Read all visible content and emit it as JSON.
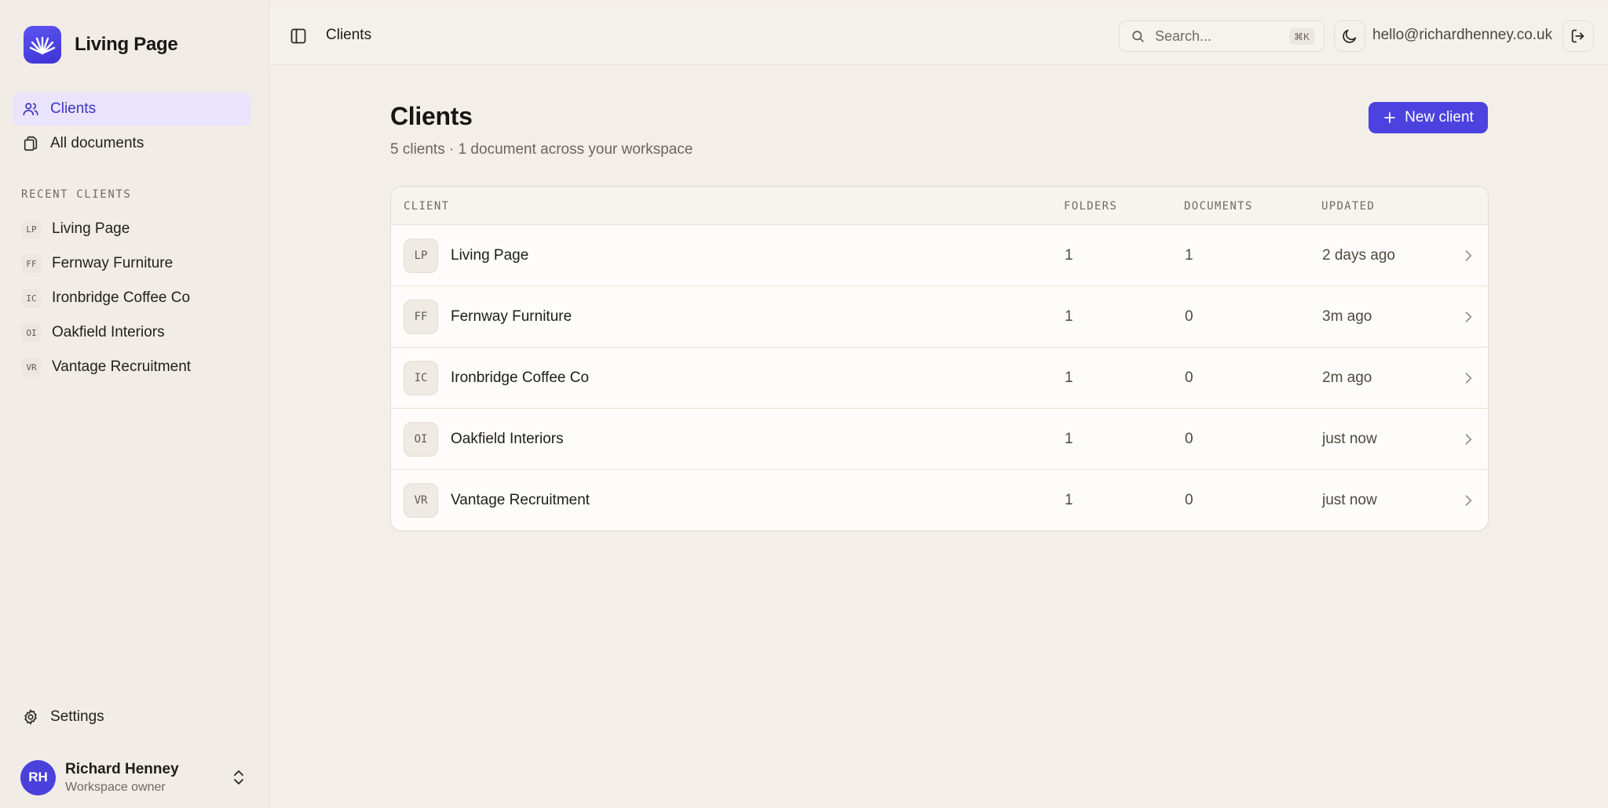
{
  "brand": {
    "name": "Living Page"
  },
  "nav": {
    "items": [
      {
        "label": "Clients",
        "icon": "users-icon",
        "active": true
      },
      {
        "label": "All documents",
        "icon": "documents-icon",
        "active": false
      }
    ]
  },
  "recent": {
    "label": "RECENT CLIENTS",
    "items": [
      {
        "initials": "LP",
        "name": "Living Page"
      },
      {
        "initials": "FF",
        "name": "Fernway Furniture"
      },
      {
        "initials": "IC",
        "name": "Ironbridge Coffee Co"
      },
      {
        "initials": "OI",
        "name": "Oakfield Interiors"
      },
      {
        "initials": "VR",
        "name": "Vantage Recruitment"
      }
    ]
  },
  "settings": {
    "label": "Settings"
  },
  "user": {
    "initials": "RH",
    "name": "Richard Henney",
    "role": "Workspace owner"
  },
  "topbar": {
    "title": "Clients",
    "search_placeholder": "Search...",
    "search_shortcut": "⌘K",
    "email": "hello@richardhenney.co.uk"
  },
  "main": {
    "title": "Clients",
    "subtitle": "5 clients · 1 document across your workspace",
    "new_button": "New client"
  },
  "table": {
    "headers": {
      "client": "CLIENT",
      "folders": "FOLDERS",
      "documents": "DOCUMENTS",
      "updated": "UPDATED"
    },
    "rows": [
      {
        "initials": "LP",
        "name": "Living Page",
        "folders": "1",
        "documents": "1",
        "updated": "2 days ago"
      },
      {
        "initials": "FF",
        "name": "Fernway Furniture",
        "folders": "1",
        "documents": "0",
        "updated": "3m ago"
      },
      {
        "initials": "IC",
        "name": "Ironbridge Coffee Co",
        "folders": "1",
        "documents": "0",
        "updated": "2m ago"
      },
      {
        "initials": "OI",
        "name": "Oakfield Interiors",
        "folders": "1",
        "documents": "0",
        "updated": "just now"
      },
      {
        "initials": "VR",
        "name": "Vantage Recruitment",
        "folders": "1",
        "documents": "0",
        "updated": "just now"
      }
    ]
  },
  "colors": {
    "accent": "#4b42e0",
    "active_bg": "#e9e4fb",
    "background": "#f3efe8"
  }
}
